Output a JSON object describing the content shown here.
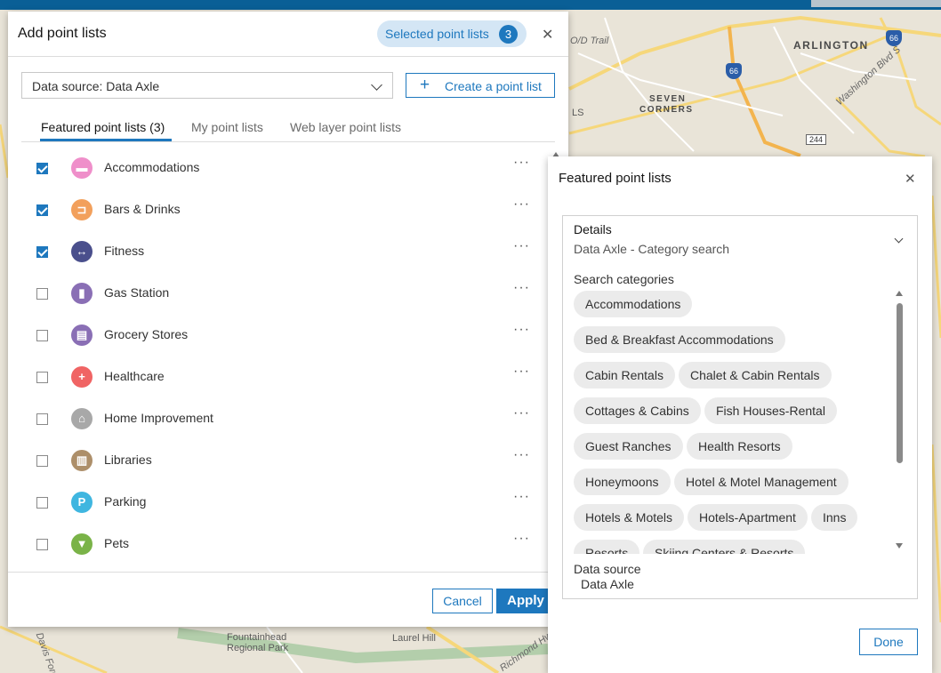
{
  "map": {
    "labels": [
      "ARLINGTON",
      "SEVEN",
      "CORNERS",
      "Washington Blvd S",
      "O/D Trail",
      "Fountainhead",
      "Regional Park",
      "Laurel Hill",
      "Richmond Hwy",
      "Davis Ford Rd",
      "LS"
    ],
    "shields": [
      "66",
      "66"
    ],
    "route_box": "244"
  },
  "dialog": {
    "title": "Add point lists",
    "selected_label": "Selected point lists",
    "selected_count": "3",
    "close_icon": "close-icon",
    "data_source": "Data source: Data Axle",
    "create_button": "Create a point list",
    "tabs": [
      {
        "label": "Featured point lists (3)",
        "active": true
      },
      {
        "label": "My point lists",
        "active": false
      },
      {
        "label": "Web layer point lists",
        "active": false
      }
    ],
    "items": [
      {
        "label": "Accommodations",
        "checked": true,
        "icon": "bed-icon",
        "glyph": "▬",
        "color": "#ef8fca"
      },
      {
        "label": "Bars & Drinks",
        "checked": true,
        "icon": "drink-icon",
        "glyph": "⊐",
        "color": "#f2a05c"
      },
      {
        "label": "Fitness",
        "checked": true,
        "icon": "dumbbell-icon",
        "glyph": "↔",
        "color": "#4a4f8c"
      },
      {
        "label": "Gas Station",
        "checked": false,
        "icon": "fuel-icon",
        "glyph": "▮",
        "color": "#8a6fb5"
      },
      {
        "label": "Grocery Stores",
        "checked": false,
        "icon": "cart-icon",
        "glyph": "▤",
        "color": "#8a6fb5"
      },
      {
        "label": "Healthcare",
        "checked": false,
        "icon": "cross-icon",
        "glyph": "+",
        "color": "#f06464"
      },
      {
        "label": "Home Improvement",
        "checked": false,
        "icon": "house-icon",
        "glyph": "⌂",
        "color": "#a8a8a8"
      },
      {
        "label": "Libraries",
        "checked": false,
        "icon": "book-icon",
        "glyph": "▥",
        "color": "#ad8f6a"
      },
      {
        "label": "Parking",
        "checked": false,
        "icon": "parking-icon",
        "glyph": "P",
        "color": "#3fb6e0"
      },
      {
        "label": "Pets",
        "checked": false,
        "icon": "pet-icon",
        "glyph": "▼",
        "color": "#7ab348"
      }
    ],
    "more_glyph": "···",
    "cancel": "Cancel",
    "apply": "Apply"
  },
  "panel": {
    "title": "Featured point lists",
    "details_title": "Details",
    "details_sub": "Data Axle - Category search",
    "categories_title": "Search categories",
    "categories": [
      [
        "Accommodations"
      ],
      [
        "Bed & Breakfast Accommodations"
      ],
      [
        "Cabin Rentals",
        "Chalet & Cabin Rentals"
      ],
      [
        "Cottages & Cabins",
        "Fish Houses-Rental"
      ],
      [
        "Guest Ranches",
        "Health Resorts"
      ],
      [
        "Honeymoons",
        "Hotel & Motel Management"
      ],
      [
        "Hotels & Motels",
        "Hotels-Apartment",
        "Inns"
      ],
      [
        "Resorts",
        "Skiing Centers & Resorts"
      ]
    ],
    "data_source_label": "Data source",
    "data_source_value": "Data Axle",
    "done": "Done"
  }
}
